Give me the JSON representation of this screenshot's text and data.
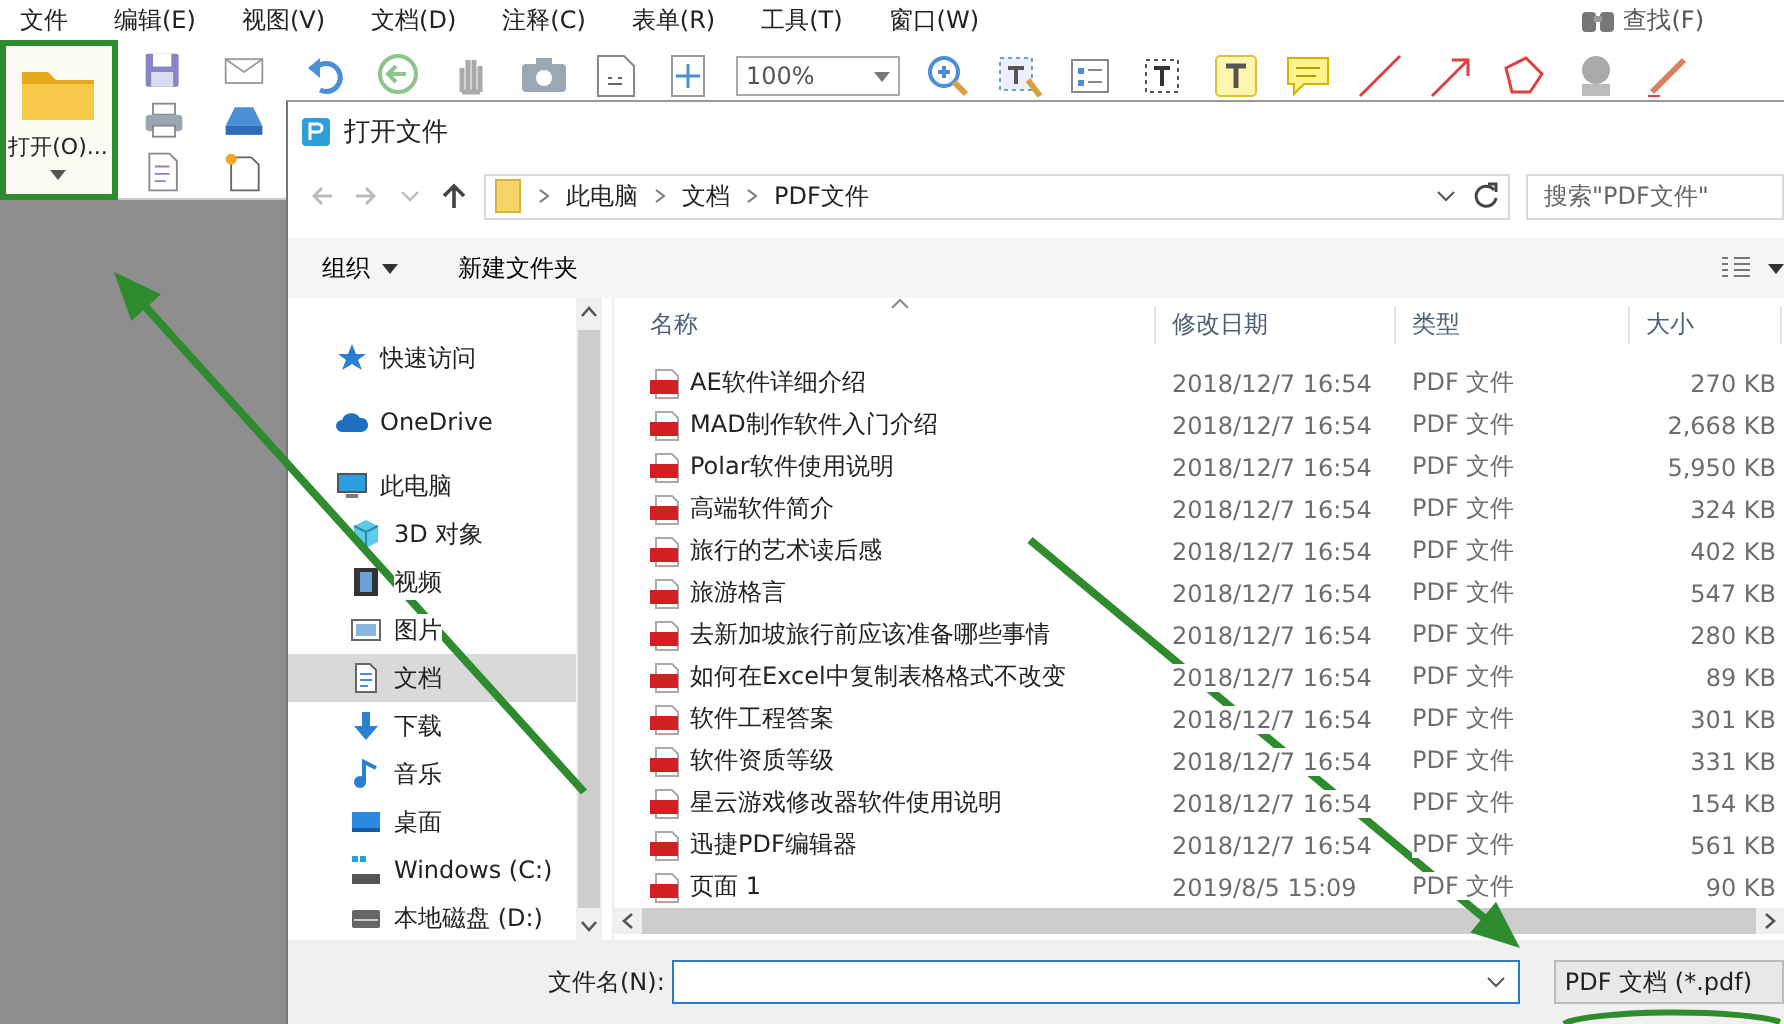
{
  "menu_bar": {
    "items": [
      "文件",
      "编辑(E)",
      "视图(V)",
      "文档(D)",
      "注释(C)",
      "表单(R)",
      "工具(T)",
      "窗口(W)"
    ],
    "find_label": "查找(F)"
  },
  "toolbar": {
    "open_button": "打开(O)...",
    "zoom": "100%"
  },
  "dialog": {
    "title": "打开文件",
    "breadcrumb": [
      "此电脑",
      "文档",
      "PDF文件"
    ],
    "search": {
      "placeholder": "搜索\"PDF文件\""
    },
    "commands": [
      {
        "label": "组织",
        "kind": "menu"
      },
      {
        "label": "新建文件夹",
        "kind": "plain"
      }
    ],
    "nav": [
      {
        "label": "快速访问",
        "kind": "star",
        "selected": false
      },
      {
        "label": "OneDrive",
        "kind": "cloud",
        "selected": false
      },
      {
        "label": "此电脑",
        "kind": "computer",
        "selected": false,
        "children": [
          {
            "label": "3D 对象",
            "kind": "cube",
            "selected": false
          },
          {
            "label": "视频",
            "kind": "film",
            "selected": false
          },
          {
            "label": "图片",
            "kind": "picture",
            "selected": false
          },
          {
            "label": "文档",
            "kind": "document",
            "selected": true
          },
          {
            "label": "下载",
            "kind": "download",
            "selected": false
          },
          {
            "label": "音乐",
            "kind": "music",
            "selected": false
          },
          {
            "label": "桌面",
            "kind": "desktop",
            "selected": false
          },
          {
            "label": "Windows (C:)",
            "kind": "system-drive",
            "selected": false
          },
          {
            "label": "本地磁盘 (D:)",
            "kind": "drive",
            "selected": false
          }
        ]
      }
    ],
    "table": {
      "columns": [
        "名称",
        "修改日期",
        "类型",
        "大小"
      ],
      "rows": [
        {
          "name": "AE软件详细介绍",
          "date": "2018/12/7 16:54",
          "type": "PDF 文件",
          "size": "270 KB"
        },
        {
          "name": "MAD制作软件入门介绍",
          "date": "2018/12/7 16:54",
          "type": "PDF 文件",
          "size": "2,668 KB"
        },
        {
          "name": "Polar软件使用说明",
          "date": "2018/12/7 16:54",
          "type": "PDF 文件",
          "size": "5,950 KB"
        },
        {
          "name": "高端软件简介",
          "date": "2018/12/7 16:54",
          "type": "PDF 文件",
          "size": "324 KB"
        },
        {
          "name": "旅行的艺术读后感",
          "date": "2018/12/7 16:54",
          "type": "PDF 文件",
          "size": "402 KB"
        },
        {
          "name": "旅游格言",
          "date": "2018/12/7 16:54",
          "type": "PDF 文件",
          "size": "547 KB"
        },
        {
          "name": "去新加坡旅行前应该准备哪些事情",
          "date": "2018/12/7 16:54",
          "type": "PDF 文件",
          "size": "280 KB"
        },
        {
          "name": "如何在Excel中复制表格格式不改变",
          "date": "2018/12/7 16:54",
          "type": "PDF 文件",
          "size": "89 KB"
        },
        {
          "name": "软件工程答案",
          "date": "2018/12/7 16:54",
          "type": "PDF 文件",
          "size": "301 KB"
        },
        {
          "name": "软件资质等级",
          "date": "2018/12/7 16:54",
          "type": "PDF 文件",
          "size": "331 KB"
        },
        {
          "name": "星云游戏修改器软件使用说明",
          "date": "2018/12/7 16:54",
          "type": "PDF 文件",
          "size": "154 KB"
        },
        {
          "name": "迅捷PDF编辑器",
          "date": "2018/12/7 16:54",
          "type": "PDF 文件",
          "size": "561 KB"
        },
        {
          "name": "页面 1",
          "date": "2019/8/5 15:09",
          "type": "PDF 文件",
          "size": "90 KB"
        }
      ]
    },
    "file_name": {
      "label": "文件名(N):"
    },
    "file_type": "PDF 文档 (*.pdf)"
  }
}
